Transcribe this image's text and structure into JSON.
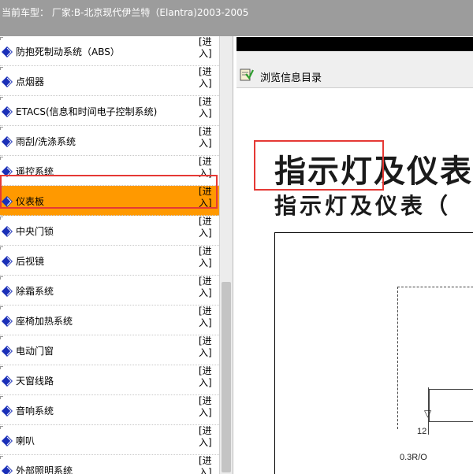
{
  "header": {
    "title": "当前车型： 厂家:B-北京现代伊兰特（Elantra)2003-2005"
  },
  "sidebar": {
    "enter_line1": "[进",
    "enter_line2": "入]",
    "items": [
      {
        "label": "防抱死制动系统（ABS）",
        "active": false
      },
      {
        "label": "点烟器",
        "active": false
      },
      {
        "label": "ETACS(信息和时间电子控制系统)",
        "active": false
      },
      {
        "label": "雨刮/洗涤系统",
        "active": false
      },
      {
        "label": "遥控系统",
        "active": false
      },
      {
        "label": "仪表板",
        "active": true
      },
      {
        "label": "中央门锁",
        "active": false
      },
      {
        "label": "后视镜",
        "active": false
      },
      {
        "label": "除霜系统",
        "active": false
      },
      {
        "label": "座椅加热系统",
        "active": false
      },
      {
        "label": "电动门窗",
        "active": false
      },
      {
        "label": "天窗线路",
        "active": false
      },
      {
        "label": "音响系统",
        "active": false
      },
      {
        "label": "喇叭",
        "active": false
      },
      {
        "label": "外部照明系统",
        "active": false
      }
    ]
  },
  "viewer": {
    "toolbar_label": "浏览信息目录",
    "doc_title": "指示灯及仪表",
    "doc_subtitle": "指示灯及仪表（",
    "pin_number": "12",
    "wire_label": "0.3R/O"
  },
  "colors": {
    "header_bg": "#9c9c9c",
    "active_row": "#ff9900",
    "highlight": "#e53935",
    "icon_blue": "#1a2fb8"
  }
}
